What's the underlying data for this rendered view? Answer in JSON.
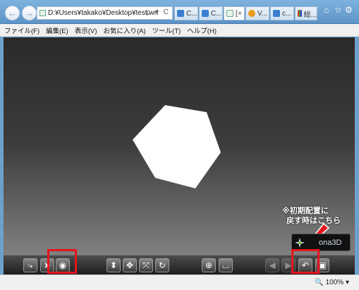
{
  "browser": {
    "address": "D:¥Users¥takako¥Desktop¥test.wrl",
    "address_tools": "ρ ▾ C",
    "tabs": [
      {
        "label": "C..."
      },
      {
        "label": "C..."
      },
      {
        "label": "[",
        "close": "×"
      },
      {
        "label": "V..."
      },
      {
        "label": "c..."
      },
      {
        "label": "総..."
      }
    ],
    "window_controls": [
      "⌂",
      "☆",
      "⚙"
    ]
  },
  "menu": {
    "items": [
      "ファイル(F)",
      "編集(E)",
      "表示(V)",
      "お気に入り(A)",
      "ツール(T)",
      "ヘルプ(H)"
    ]
  },
  "viewer": {
    "annotation_line1": "※初期配置に",
    "annotation_line2": "戻す時はこちら",
    "logo_text": "ona3D",
    "highlight_color": "#e8141c",
    "toolbar_buttons": [
      {
        "icon": "walk-icon",
        "glyph": "⤷"
      },
      {
        "icon": "fly-icon",
        "glyph": "➤"
      },
      {
        "icon": "examine-eye-icon",
        "glyph": "◉"
      },
      {
        "icon": "plan-icon",
        "glyph": "⬍"
      },
      {
        "icon": "pan-icon",
        "glyph": "✥"
      },
      {
        "icon": "tilt-icon",
        "glyph": "⤧"
      },
      {
        "icon": "rotate-icon",
        "glyph": "↻"
      },
      {
        "icon": "goto-icon",
        "glyph": "⊕"
      },
      {
        "icon": "straighten-icon",
        "glyph": "⌴"
      },
      {
        "icon": "prev-viewpoint-icon",
        "glyph": "◀"
      },
      {
        "icon": "next-viewpoint-icon",
        "glyph": "▶"
      },
      {
        "icon": "restore-viewpoint-icon",
        "glyph": "↶"
      },
      {
        "icon": "fit-icon",
        "glyph": "▣"
      }
    ]
  },
  "status": {
    "zoom": "100%"
  }
}
